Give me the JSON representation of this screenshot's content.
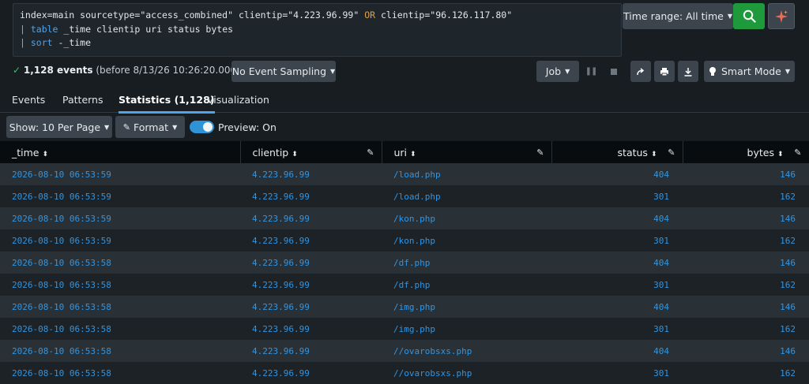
{
  "search": {
    "lines": [
      {
        "parts": [
          {
            "t": "index=main sourcetype=\"access_combined\" clientip=\"4.223.96.99\" ",
            "c": ""
          },
          {
            "t": "OR",
            "c": "kw-or"
          },
          {
            "t": " clientip=\"96.126.117.80\"",
            "c": ""
          }
        ]
      },
      {
        "parts": [
          {
            "t": "| ",
            "c": "kw-pipe"
          },
          {
            "t": "table",
            "c": "kw-cmd"
          },
          {
            "t": " _time clientip uri status bytes",
            "c": ""
          }
        ]
      },
      {
        "parts": [
          {
            "t": "| ",
            "c": "kw-pipe"
          },
          {
            "t": "sort",
            "c": "kw-cmd"
          },
          {
            "t": " -_time",
            "c": ""
          }
        ]
      }
    ],
    "time_range_label": "Time range: All time",
    "colors": {
      "search_button": "#1e9a3c",
      "accent": "#4fa3e8"
    }
  },
  "status": {
    "check": "✓",
    "count": "1,128 events",
    "detail": " (before 8/13/26 10:26:20.000 PM)",
    "sampling_label": "No Event Sampling",
    "job_label": "Job",
    "smart_mode_label": "Smart Mode"
  },
  "tabs": [
    {
      "label": "Events",
      "active": false
    },
    {
      "label": "Patterns",
      "active": false
    },
    {
      "label": "Statistics (1,128)",
      "active": true
    },
    {
      "label": "Visualization",
      "active": false
    }
  ],
  "toolbar": {
    "show_label": "Show: 10 Per Page",
    "format_label": "Format",
    "preview_label": "Preview: On",
    "preview_on": true
  },
  "table": {
    "columns": [
      {
        "label": "_time",
        "align": "left",
        "editable": false
      },
      {
        "label": "clientip",
        "align": "left",
        "editable": true
      },
      {
        "label": "uri",
        "align": "left",
        "editable": true
      },
      {
        "label": "status",
        "align": "right",
        "editable": true
      },
      {
        "label": "bytes",
        "align": "right",
        "editable": true
      }
    ],
    "rows": [
      [
        "2026-08-10 06:53:59",
        "4.223.96.99",
        "/load.php",
        "404",
        "146"
      ],
      [
        "2026-08-10 06:53:59",
        "4.223.96.99",
        "/load.php",
        "301",
        "162"
      ],
      [
        "2026-08-10 06:53:59",
        "4.223.96.99",
        "/kon.php",
        "404",
        "146"
      ],
      [
        "2026-08-10 06:53:59",
        "4.223.96.99",
        "/kon.php",
        "301",
        "162"
      ],
      [
        "2026-08-10 06:53:58",
        "4.223.96.99",
        "/df.php",
        "404",
        "146"
      ],
      [
        "2026-08-10 06:53:58",
        "4.223.96.99",
        "/df.php",
        "301",
        "162"
      ],
      [
        "2026-08-10 06:53:58",
        "4.223.96.99",
        "/img.php",
        "404",
        "146"
      ],
      [
        "2026-08-10 06:53:58",
        "4.223.96.99",
        "/img.php",
        "301",
        "162"
      ],
      [
        "2026-08-10 06:53:58",
        "4.223.96.99",
        "//ovarobsxs.php",
        "404",
        "146"
      ],
      [
        "2026-08-10 06:53:58",
        "4.223.96.99",
        "//ovarobsxs.php",
        "301",
        "162"
      ]
    ]
  },
  "icons": {
    "search": "magnifier-icon",
    "ai": "sparkle-icon",
    "pause": "pause-icon",
    "stop": "stop-icon",
    "share": "share-icon",
    "print": "print-icon",
    "export": "download-icon",
    "smart": "lightbulb-icon",
    "sort": "sort-icon",
    "edit": "pencil-icon"
  }
}
